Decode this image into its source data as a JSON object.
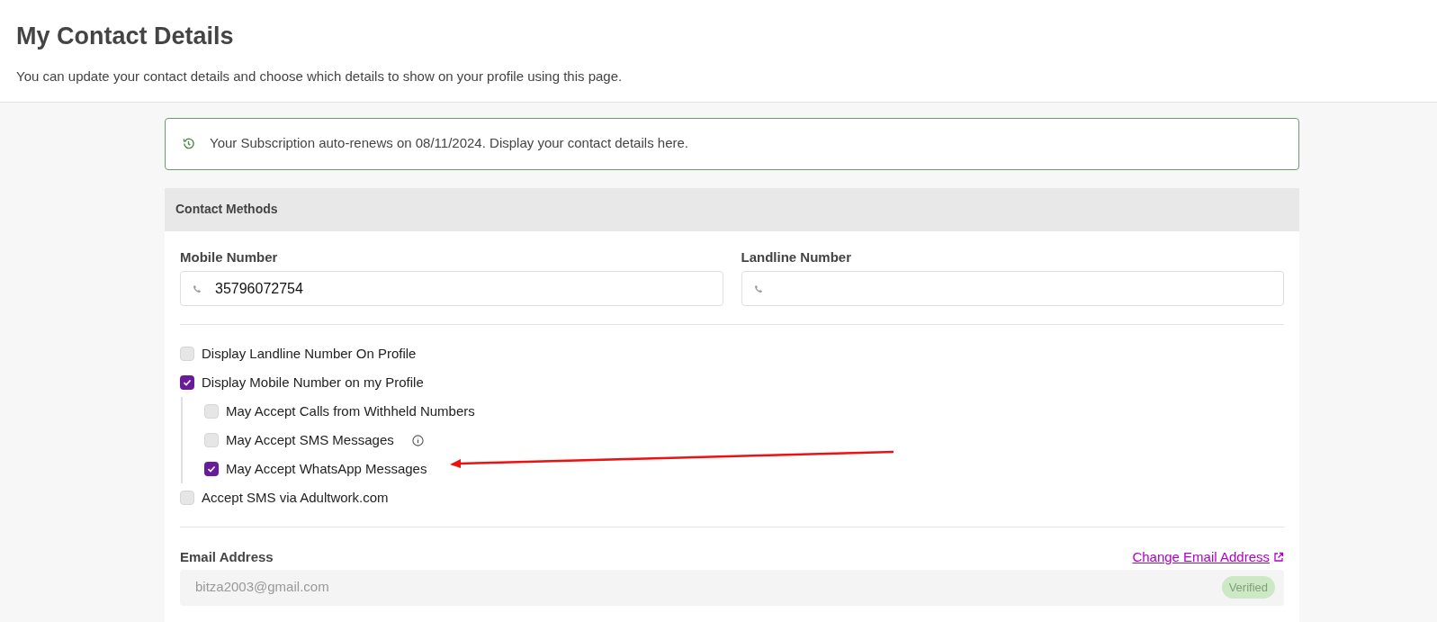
{
  "header": {
    "title": "My Contact Details",
    "subtitle": "You can update your contact details and choose which details to show on your profile using this page."
  },
  "notice": {
    "text": "Your Subscription auto-renews on 08/11/2024. Display your contact details here."
  },
  "card": {
    "title": "Contact Methods",
    "phone_fields": [
      {
        "label": "Mobile Number",
        "value": "35796072754"
      },
      {
        "label": "Landline Number"
      }
    ],
    "options": [
      {
        "label": "Display Landline Number On Profile",
        "checked": false
      },
      {
        "label": "Display Mobile Number on my Profile",
        "checked": true,
        "children": [
          {
            "label": "May Accept Calls from Withheld Numbers",
            "checked": false,
            "info": false
          },
          {
            "label": "May Accept SMS Messages",
            "checked": false,
            "info": true
          },
          {
            "label": "May Accept WhatsApp Messages",
            "checked": true,
            "info": false
          }
        ]
      },
      {
        "label": "Accept SMS via Adultwork.com",
        "checked": false
      }
    ],
    "email": {
      "label": "Email Address",
      "link": "Change Email Address",
      "value": "bitza2003@gmail.com",
      "badge": "Verified"
    }
  }
}
